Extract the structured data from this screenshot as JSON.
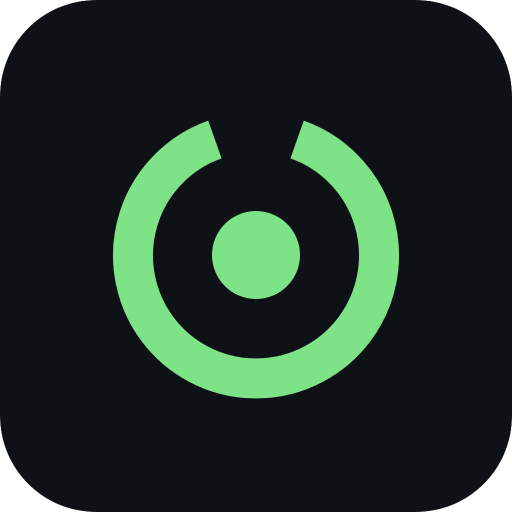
{
  "app_icon": {
    "name": "power-ring-icon",
    "colors": {
      "background": "#0e1116",
      "accent": "#7ee287"
    }
  }
}
